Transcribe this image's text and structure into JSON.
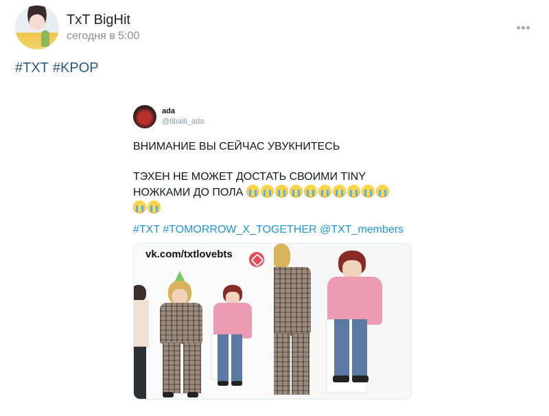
{
  "post": {
    "author": "TxT BigHit",
    "time": "сегодня в 5:00",
    "tags": [
      "#TXT",
      "#KPOP"
    ]
  },
  "tweet": {
    "name": "ada",
    "handle": "@tibaiti_ada",
    "line1": "ВНИМАНИЕ ВЫ СЕЙЧАС УВУКНИТЕСЬ",
    "line2": "ТЭХЕН НЕ МОЖЕТ ДОСТАТЬ СВОИМИ TINY",
    "line3": "НОЖКАМИ ДО ПОЛА",
    "emoji_row1": "loudly-crying-face x10",
    "emoji_row2": "loudly-crying-face x2",
    "tags": "#TXT #TOMORROW_X_TOGETHER @TXT_members"
  },
  "media": {
    "watermark": "vk.com/txtlovebts"
  },
  "icons": {
    "more": "more-dots-icon",
    "emoji": "loudly-crying-face-icon",
    "logo": "watermark-logo-icon"
  },
  "colors": {
    "link": "#2a5885",
    "tweet_link": "#1b95e0",
    "muted": "#8c8c8c"
  }
}
